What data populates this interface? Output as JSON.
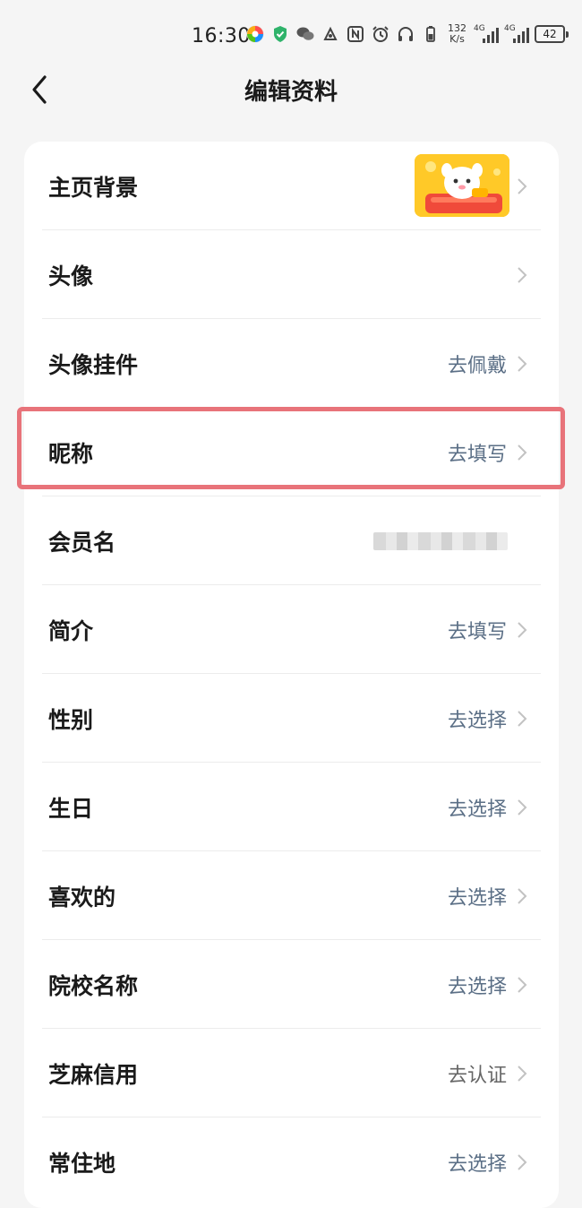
{
  "status_bar": {
    "time": "16:30",
    "net_speed_value": "132",
    "net_speed_unit": "K/s",
    "signal1_tag": "4G",
    "signal2_tag": "4G",
    "battery": "42"
  },
  "header": {
    "title": "编辑资料"
  },
  "rows": [
    {
      "label": "主页背景",
      "value": ""
    },
    {
      "label": "头像",
      "value": ""
    },
    {
      "label": "头像挂件",
      "value": "去佩戴"
    },
    {
      "label": "昵称",
      "value": "去填写"
    },
    {
      "label": "会员名",
      "value": ""
    },
    {
      "label": "简介",
      "value": "去填写"
    },
    {
      "label": "性别",
      "value": "去选择"
    },
    {
      "label": "生日",
      "value": "去选择"
    },
    {
      "label": "喜欢的",
      "value": "去选择"
    },
    {
      "label": "院校名称",
      "value": "去选择"
    },
    {
      "label": "芝麻信用",
      "value": "去认证"
    },
    {
      "label": "常住地",
      "value": "去选择"
    }
  ],
  "colors": {
    "link_value": "#5b6f86",
    "gray_value": "#666666",
    "highlight_border": "#e8737a",
    "page_bg": "#f5f5f5"
  }
}
